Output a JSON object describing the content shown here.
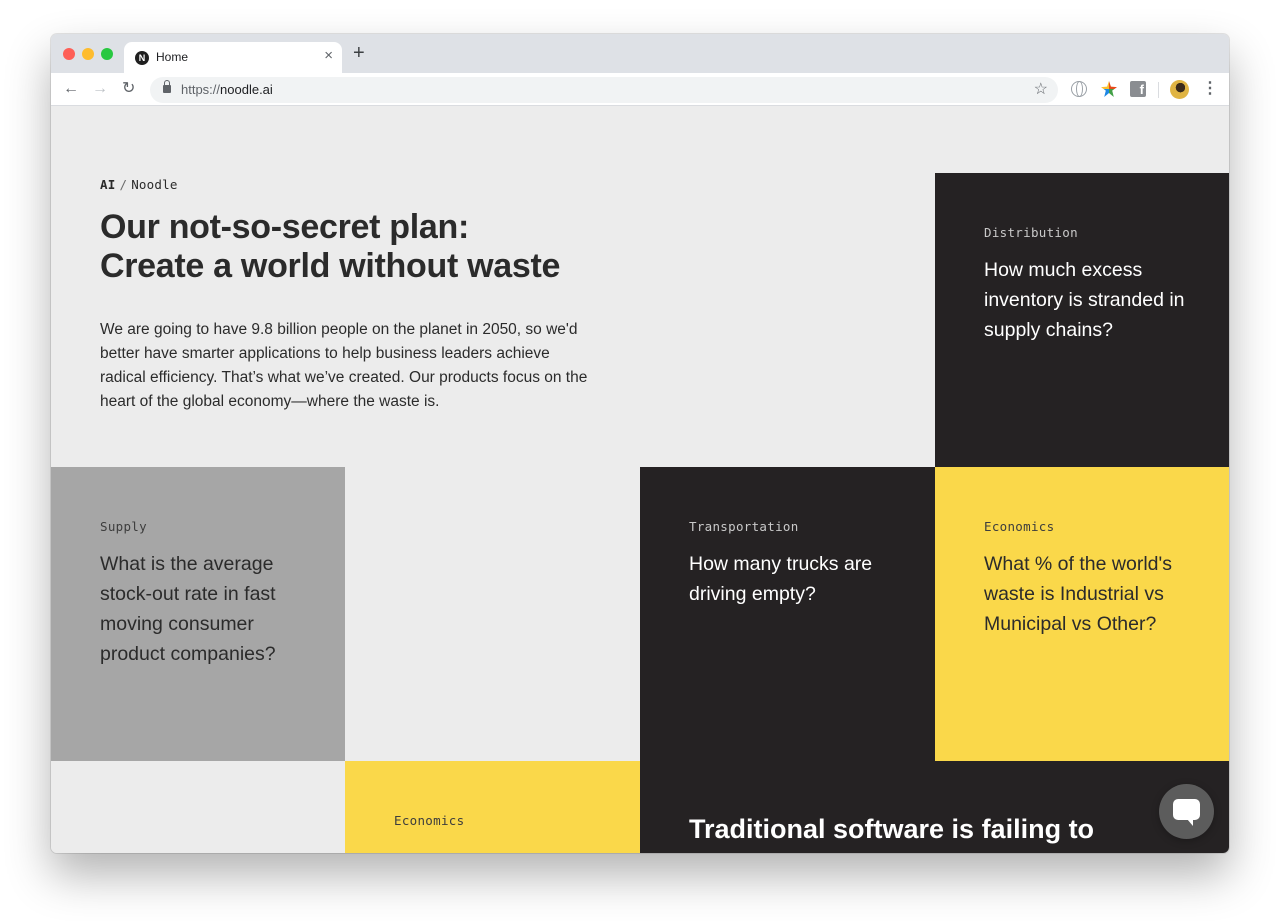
{
  "browser": {
    "tab": {
      "title": "Home",
      "favicon": "N",
      "close": "×"
    },
    "new_tab": "+",
    "nav": {
      "back": "←",
      "forward": "→",
      "reload": "↻"
    },
    "address": {
      "scheme": "https://",
      "host": "noodle.ai"
    },
    "star": "☆",
    "menu": "⋮",
    "extensions": [
      "globe-icon",
      "puzzle-extension-icon",
      "facebook-icon"
    ],
    "facebook_glyph": "f"
  },
  "page": {
    "breadcrumb": {
      "root": "AI",
      "separator": "/",
      "current": "Noodle"
    },
    "hero": {
      "title_line1": "Our not-so-secret plan:",
      "title_line2": "Create a world without waste",
      "body": "We are going to have 9.8 billion people on the planet in 2050, so we'd better have smarter applications to help business leaders achieve radical efficiency. That’s what we’ve created. Our products focus on the heart of the global economy—where the waste is."
    },
    "cards": {
      "distribution": {
        "label": "Distribution",
        "question": "How much excess inventory is stranded in supply chains?"
      },
      "supply": {
        "label": "Supply",
        "question": "What is the average stock-out rate in fast moving consumer product companies?"
      },
      "transportation": {
        "label": "Transportation",
        "question": "How many trucks are driving empty?"
      },
      "economics_1": {
        "label": "Economics",
        "question": "What % of the world's waste is Industrial vs Municipal vs Other?"
      },
      "economics_2": {
        "label": "Economics"
      }
    },
    "bottom_heading": "Traditional software is failing to"
  },
  "colors": {
    "dark": "#252223",
    "yellow": "#fad84a",
    "grey": "#a6a6a6",
    "page_bg": "#ececec"
  }
}
